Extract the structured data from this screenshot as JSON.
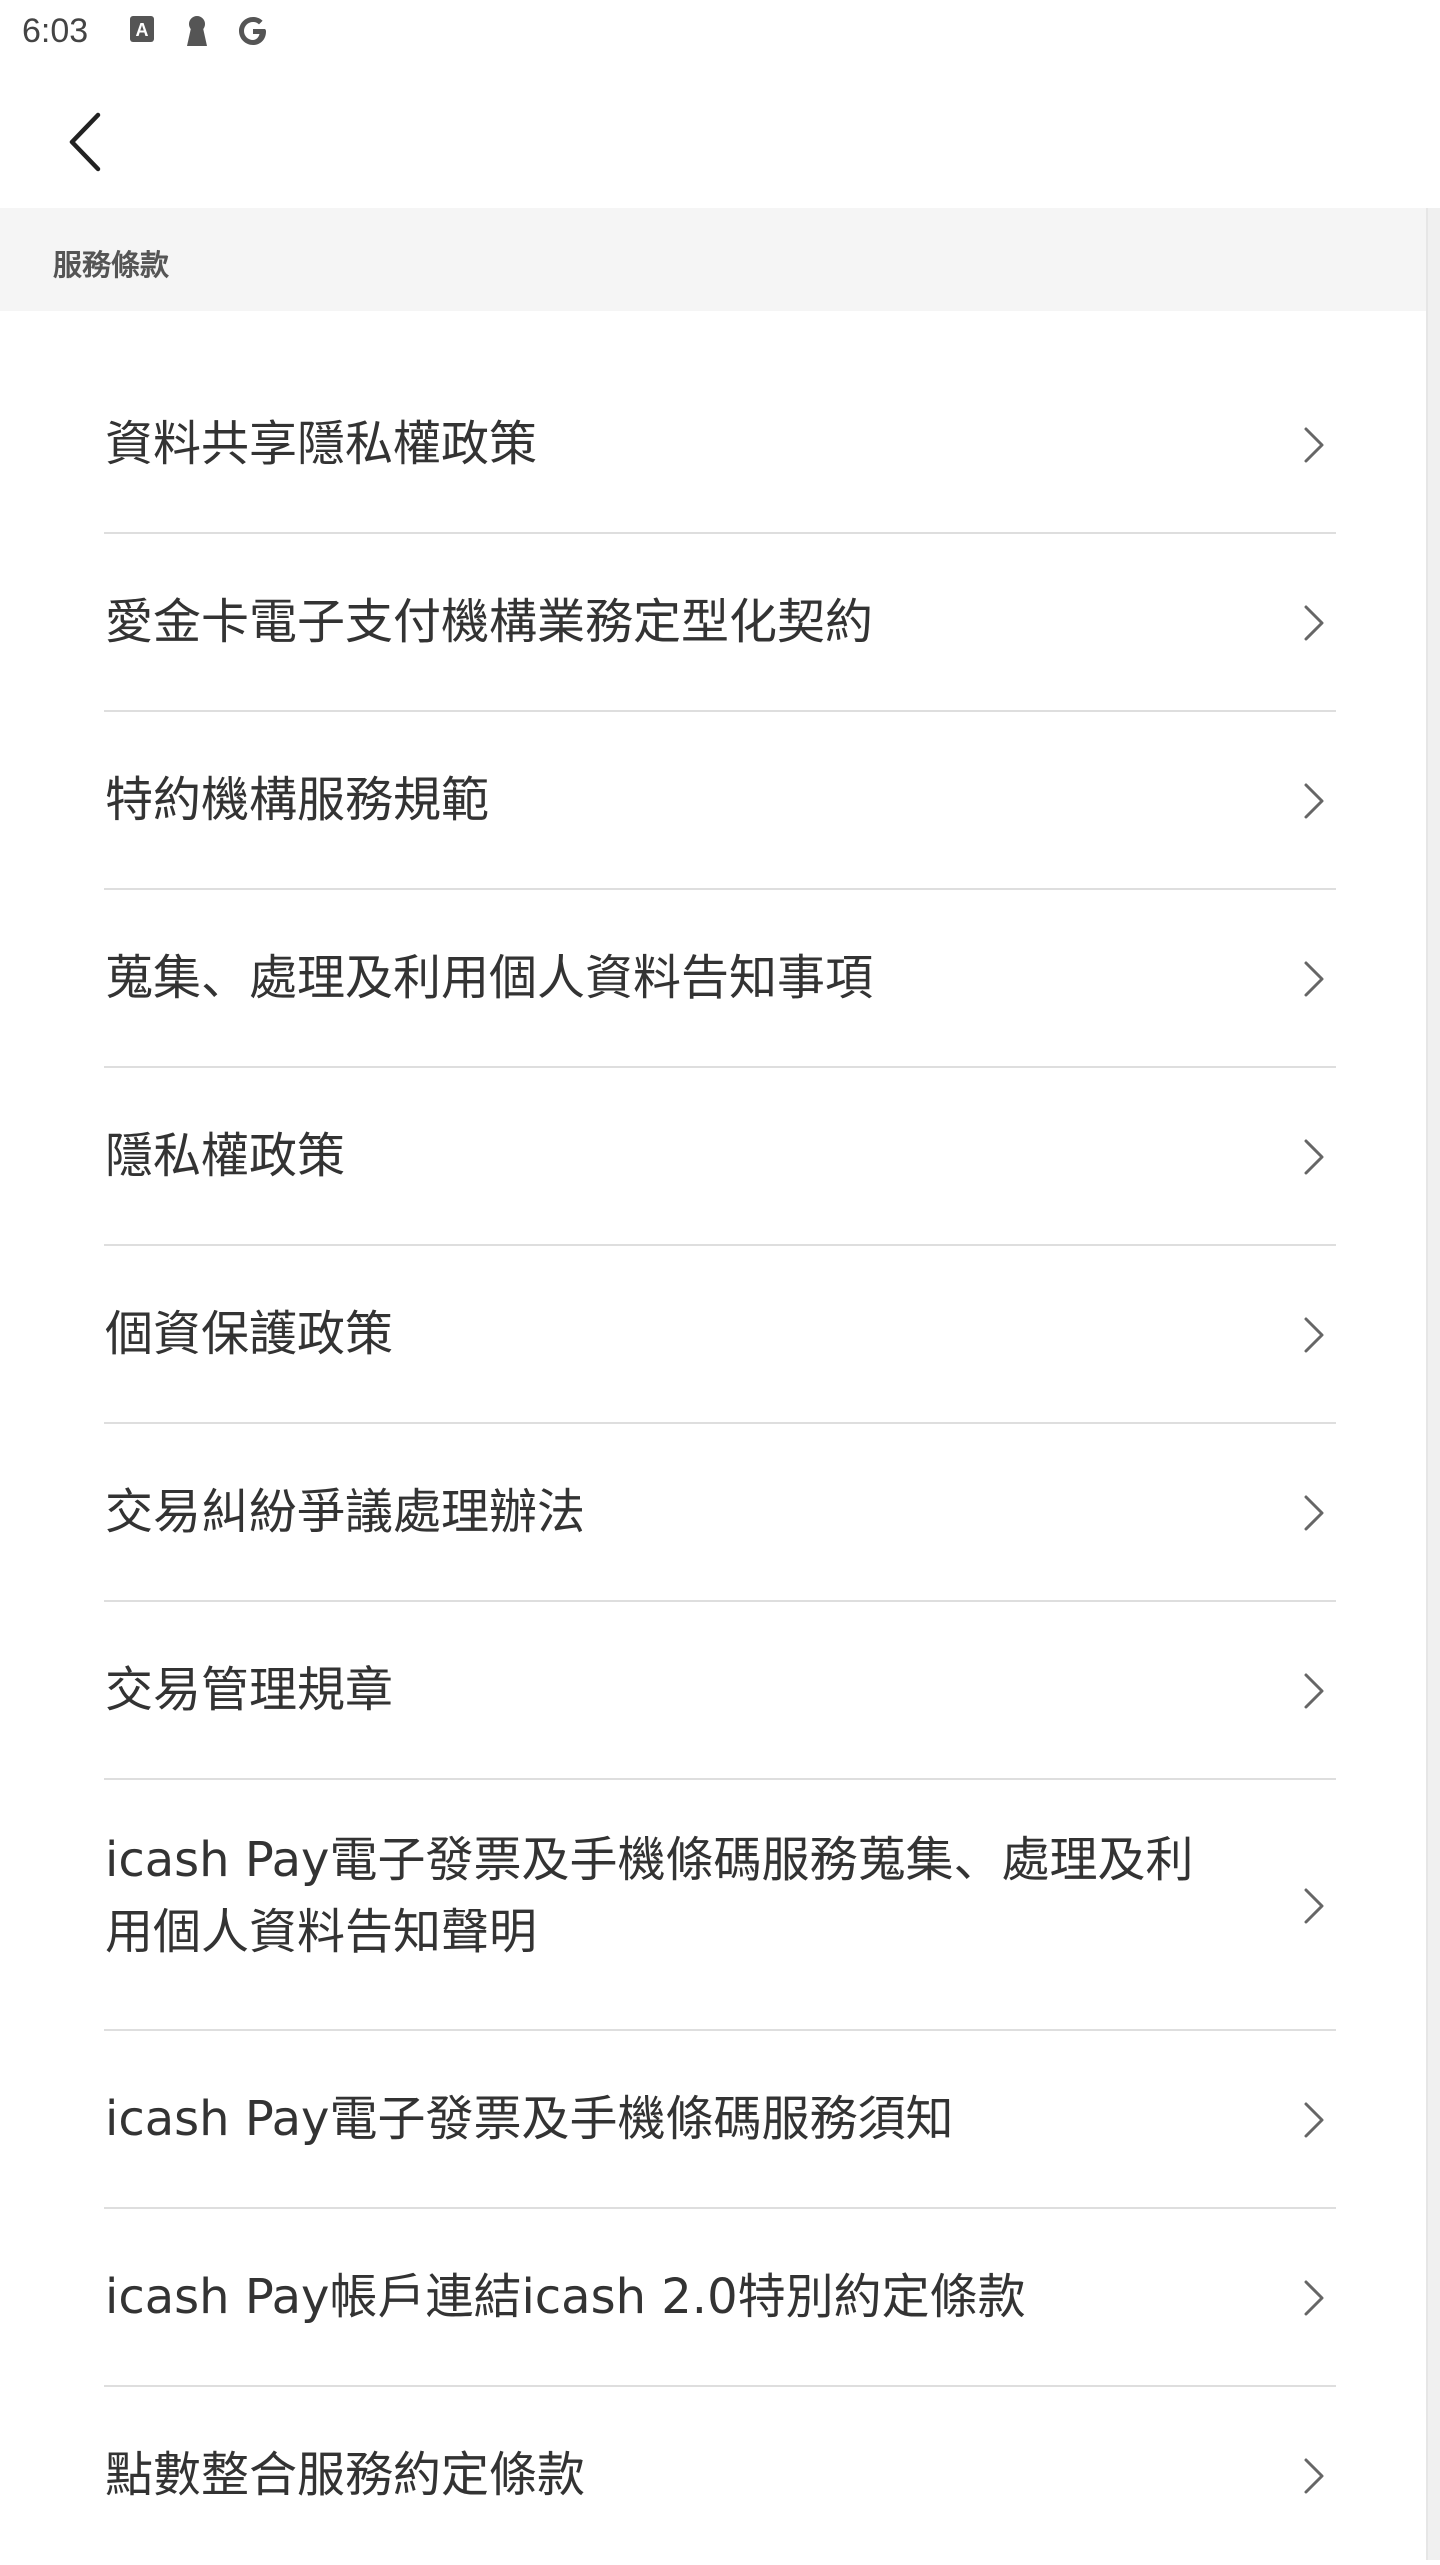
{
  "status_bar": {
    "time": "6:03",
    "icons": [
      "font-a-icon",
      "keyhole-icon",
      "google-g-icon"
    ]
  },
  "top_bar": {
    "back_icon": "chevron-left-icon"
  },
  "section": {
    "title": "服務條款"
  },
  "terms": [
    {
      "label": "資料共享隱私權政策"
    },
    {
      "label": "愛金卡電子支付機構業務定型化契約"
    },
    {
      "label": "特約機構服務規範"
    },
    {
      "label": "蒐集、處理及利用個人資料告知事項"
    },
    {
      "label": "隱私權政策"
    },
    {
      "label": "個資保護政策"
    },
    {
      "label": "交易糾紛爭議處理辦法"
    },
    {
      "label": "交易管理規章"
    },
    {
      "label": "icash Pay電子發票及手機條碼服務蒐集、處理及利用個人資料告知聲明"
    },
    {
      "label": "icash Pay電子發票及手機條碼服務須知"
    },
    {
      "label": "icash Pay帳戶連結icash 2.0特別約定條款"
    },
    {
      "label": "點數整合服務約定條款"
    }
  ],
  "colors": {
    "text": "#333333",
    "section_bg": "#f5f5f5",
    "divider": "#dedede",
    "chevron": "#666666"
  }
}
